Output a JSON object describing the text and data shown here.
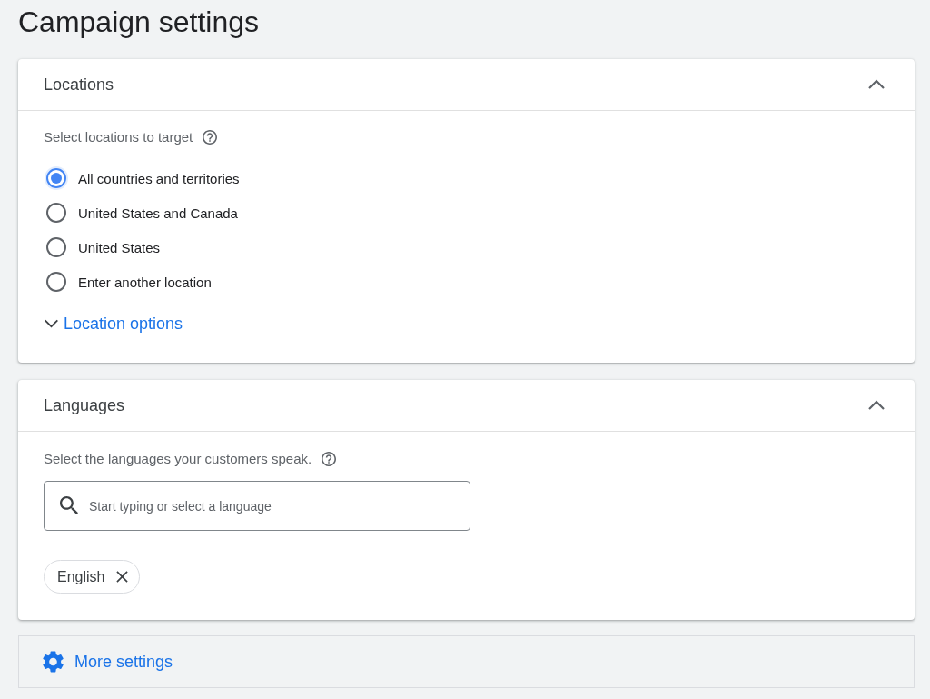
{
  "page": {
    "title": "Campaign settings"
  },
  "sections": [
    {
      "kind": "locations",
      "title": "Locations",
      "expanded": true,
      "prompt": "Select locations to target",
      "options": [
        {
          "label": "All countries and territories",
          "selected": true
        },
        {
          "label": "United States and Canada",
          "selected": false
        },
        {
          "label": "United States",
          "selected": false
        },
        {
          "label": "Enter another location",
          "selected": false
        }
      ],
      "link": {
        "label": "Location options",
        "expanded": false
      }
    },
    {
      "kind": "languages",
      "title": "Languages",
      "expanded": true,
      "prompt": "Select the languages your customers speak.",
      "search": {
        "placeholder": "Start typing or select a language"
      },
      "chips": [
        {
          "label": "English"
        }
      ]
    }
  ],
  "more_settings": {
    "label": "More settings"
  }
}
